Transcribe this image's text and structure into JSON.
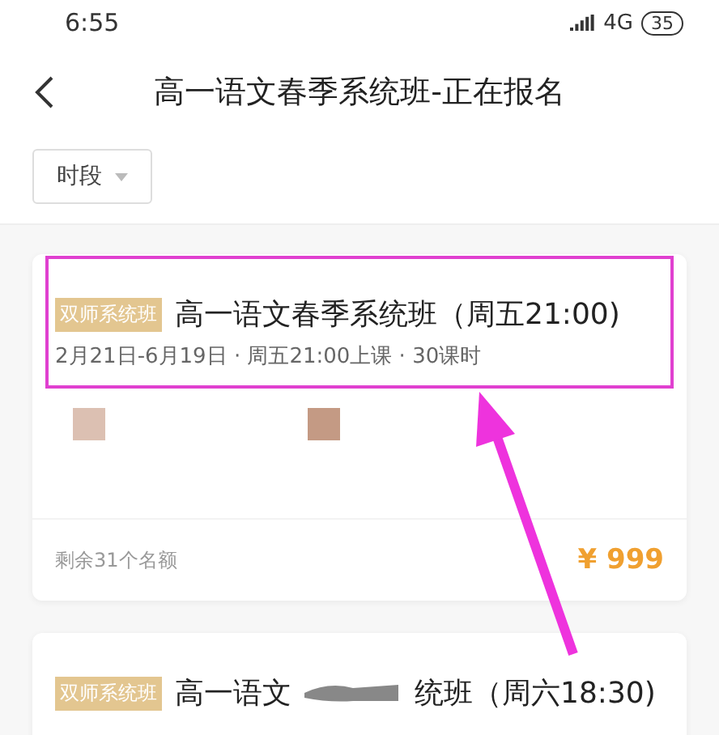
{
  "status_bar": {
    "time": "6:55",
    "network": "4G",
    "battery": "35"
  },
  "header": {
    "title": "高一语文春季系统班-正在报名"
  },
  "filter": {
    "label": "时段"
  },
  "courses": [
    {
      "tag": "双师系统班",
      "title": "高一语文春季系统班（周五21:00)",
      "schedule": "2月21日-6月19日 · 周五21:00上课 · 30课时",
      "teachers": [
        {
          "color": "#dcc0b2"
        },
        {
          "color": "#c49a84"
        }
      ],
      "remaining": "剩余31个名额",
      "price": "¥ 999",
      "highlighted": true
    },
    {
      "tag": "双师系统班",
      "title_start": "高一语文",
      "title_end": "统班（周六18:30)",
      "highlighted": false
    }
  ]
}
